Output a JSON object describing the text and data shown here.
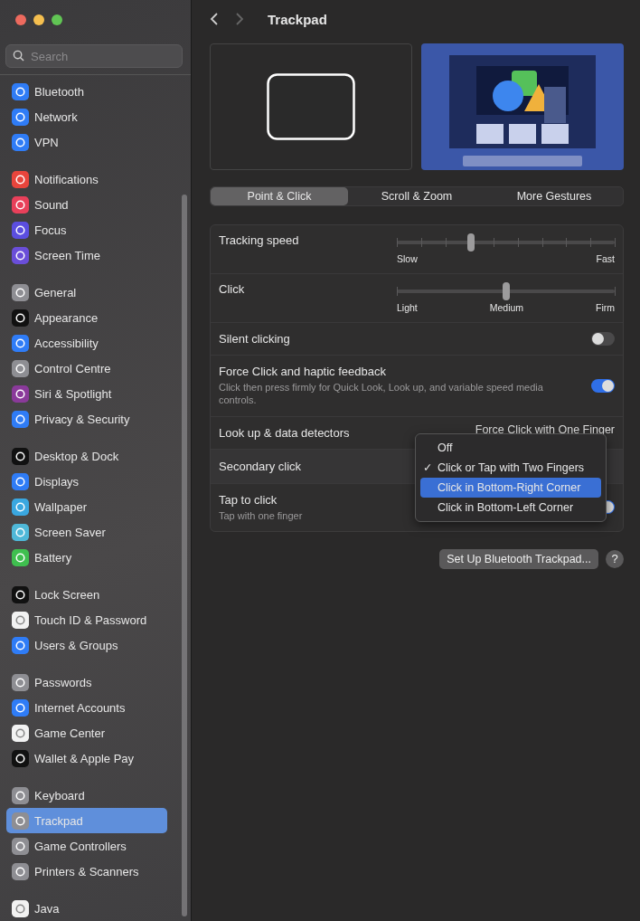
{
  "window": {
    "title": "Trackpad"
  },
  "search": {
    "placeholder": "Search"
  },
  "sidebar": {
    "groups": [
      {
        "items": [
          {
            "label": "Bluetooth",
            "color": "#2f7cf6",
            "selected": false
          },
          {
            "label": "Network",
            "color": "#2f7cf6",
            "selected": false
          },
          {
            "label": "VPN",
            "color": "#2f7cf6",
            "selected": false
          }
        ]
      },
      {
        "items": [
          {
            "label": "Notifications",
            "color": "#e8453c",
            "selected": false
          },
          {
            "label": "Sound",
            "color": "#e8405a",
            "selected": false
          },
          {
            "label": "Focus",
            "color": "#5b4ee0",
            "selected": false
          },
          {
            "label": "Screen Time",
            "color": "#6a4ed9",
            "selected": false
          }
        ]
      },
      {
        "items": [
          {
            "label": "General",
            "color": "#8e8e93",
            "selected": false
          },
          {
            "label": "Appearance",
            "color": "#111111",
            "selected": false
          },
          {
            "label": "Accessibility",
            "color": "#2f7cf6",
            "selected": false
          },
          {
            "label": "Control Centre",
            "color": "#8e8e93",
            "selected": false
          },
          {
            "label": "Siri & Spotlight",
            "color": "#8a3a9a",
            "selected": false
          },
          {
            "label": "Privacy & Security",
            "color": "#2f7cf6",
            "selected": false
          }
        ]
      },
      {
        "items": [
          {
            "label": "Desktop & Dock",
            "color": "#111111",
            "selected": false
          },
          {
            "label": "Displays",
            "color": "#2f7cf6",
            "selected": false
          },
          {
            "label": "Wallpaper",
            "color": "#3aa7e0",
            "selected": false
          },
          {
            "label": "Screen Saver",
            "color": "#4fb8d8",
            "selected": false
          },
          {
            "label": "Battery",
            "color": "#3fbf4f",
            "selected": false
          }
        ]
      },
      {
        "items": [
          {
            "label": "Lock Screen",
            "color": "#111111",
            "selected": false
          },
          {
            "label": "Touch ID & Password",
            "color": "#f2f2f2",
            "selected": false
          },
          {
            "label": "Users & Groups",
            "color": "#2f7cf6",
            "selected": false
          }
        ]
      },
      {
        "items": [
          {
            "label": "Passwords",
            "color": "#8e8e93",
            "selected": false
          },
          {
            "label": "Internet Accounts",
            "color": "#2f7cf6",
            "selected": false
          },
          {
            "label": "Game Center",
            "color": "#f2f2f2",
            "selected": false
          },
          {
            "label": "Wallet & Apple Pay",
            "color": "#111111",
            "selected": false
          }
        ]
      },
      {
        "items": [
          {
            "label": "Keyboard",
            "color": "#8e8e93",
            "selected": false
          },
          {
            "label": "Trackpad",
            "color": "#8e8e93",
            "selected": true
          },
          {
            "label": "Game Controllers",
            "color": "#8e8e93",
            "selected": false
          },
          {
            "label": "Printers & Scanners",
            "color": "#8e8e93",
            "selected": false
          }
        ]
      },
      {
        "items": [
          {
            "label": "Java",
            "color": "#f2f2f2",
            "selected": false
          }
        ]
      }
    ]
  },
  "tabs": [
    {
      "label": "Point & Click",
      "selected": true
    },
    {
      "label": "Scroll & Zoom",
      "selected": false
    },
    {
      "label": "More Gestures",
      "selected": false
    }
  ],
  "settings": [
    {
      "kind": "slider",
      "label": "Tracking speed",
      "level": 0.34,
      "marks": [
        "Slow",
        "Fast"
      ]
    },
    {
      "kind": "slider",
      "label": "Click",
      "level": 0.5,
      "marks": [
        "Light",
        "Medium",
        "Firm"
      ]
    },
    {
      "kind": "toggle",
      "label": "Silent clicking",
      "on": false
    },
    {
      "kind": "toggle",
      "label": "Force Click and haptic feedback",
      "description": "Click then press firmly for Quick Look, Look up, and variable speed media controls.",
      "on": true
    },
    {
      "kind": "popup",
      "label": "Look up & data detectors",
      "value": "Force Click with One Finger"
    },
    {
      "kind": "menu",
      "label": "Secondary click"
    },
    {
      "kind": "toggle",
      "label": "Tap to click",
      "description": "Tap with one finger",
      "on": true
    }
  ],
  "menu": {
    "items": [
      {
        "label": "Off",
        "checked": false,
        "selected": false
      },
      {
        "label": "Click or Tap with Two Fingers",
        "checked": true,
        "selected": false
      },
      {
        "label": "Click in Bottom-Right Corner",
        "checked": false,
        "selected": true
      },
      {
        "label": "Click in Bottom-Left Corner",
        "checked": false,
        "selected": false
      }
    ],
    "check_glyph": "✓"
  },
  "footer": {
    "button": "Set Up Bluetooth Trackpad...",
    "help": "?"
  }
}
